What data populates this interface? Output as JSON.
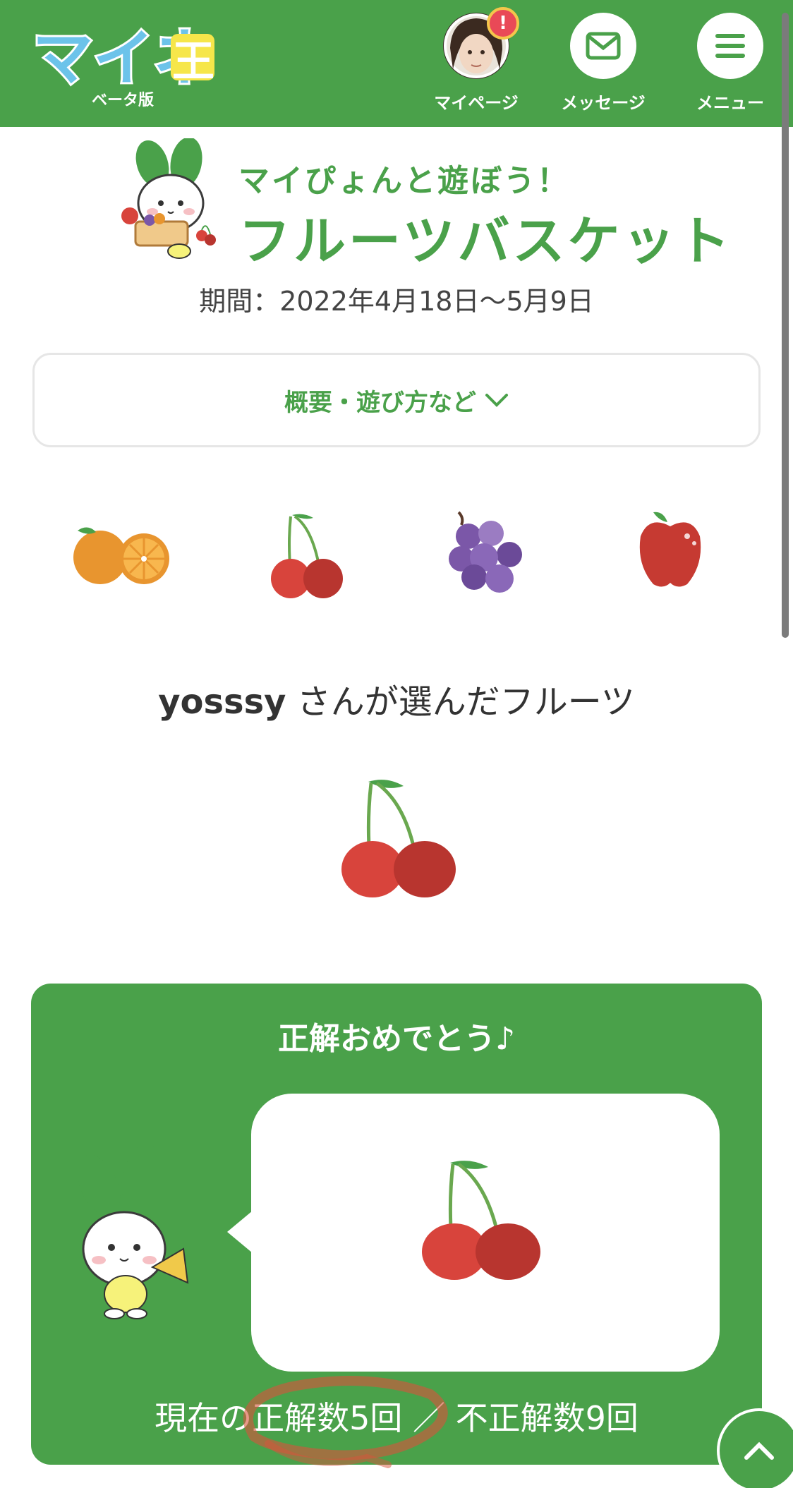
{
  "header": {
    "logo_text": "マイネ王",
    "beta_label": "ベータ版",
    "nav": [
      {
        "label": "マイページ",
        "icon": "avatar",
        "badge": "!"
      },
      {
        "label": "メッセージ",
        "icon": "envelope-icon"
      },
      {
        "label": "メニュー",
        "icon": "hamburger-icon"
      }
    ]
  },
  "hero": {
    "subtitle": "マイぴょんと遊ぼう！",
    "title": "フルーツバスケット",
    "period": "期間：2022年4月18日〜5月9日"
  },
  "accordion": {
    "label": "概要・遊び方など"
  },
  "fruits": [
    "orange",
    "cherry",
    "grape",
    "apple"
  ],
  "chosen": {
    "user": "yosssy",
    "suffix": "さんが選んだフルーツ",
    "fruit": "cherry"
  },
  "result": {
    "title": "正解おめでとう♪",
    "fruit": "cherry",
    "score_text": "現在の正解数5回 ／ 不正解数9回"
  },
  "colors": {
    "brand_green": "#4aa14a",
    "cherry_red": "#d8443c",
    "grape_purple": "#7b57a8",
    "orange": "#e8952f"
  }
}
